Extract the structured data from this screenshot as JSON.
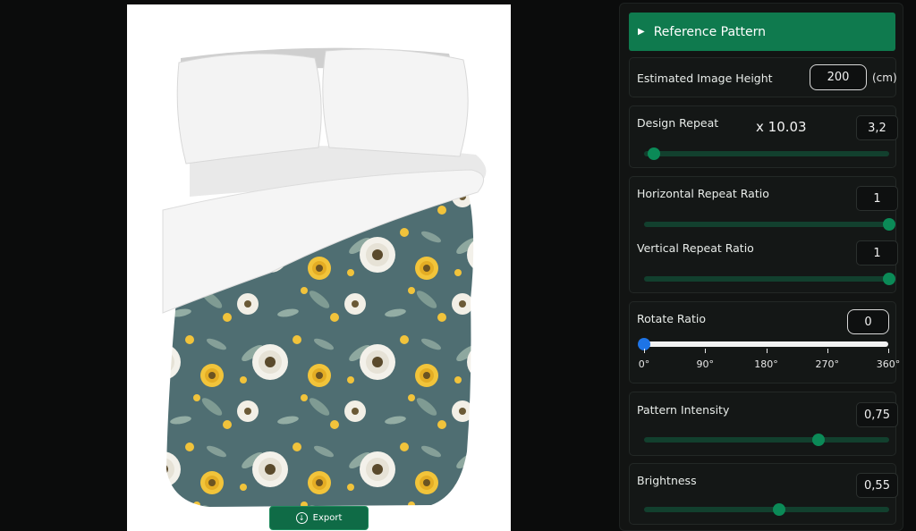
{
  "preview": {
    "export_label": "Export",
    "export_icon": "download-icon"
  },
  "panel": {
    "reference_pattern_label": "Reference Pattern",
    "image_height": {
      "label": "Estimated Image Height",
      "value": "200",
      "unit": "(cm)"
    },
    "design_repeat": {
      "label": "Design Repeat",
      "multiplier": "x 10.03",
      "value": "3,2",
      "slider_fraction": 0.04
    },
    "horizontal_repeat": {
      "label": "Horizontal Repeat Ratio",
      "value": "1",
      "slider_fraction": 1.0
    },
    "vertical_repeat": {
      "label": "Vertical Repeat Ratio",
      "value": "1",
      "slider_fraction": 1.0
    },
    "rotate": {
      "label": "Rotate Ratio",
      "value": "0",
      "slider_fraction": 0.0,
      "ticks": [
        "0°",
        "90°",
        "180°",
        "270°",
        "360°"
      ]
    },
    "pattern_intensity": {
      "label": "Pattern Intensity",
      "value": "0,75",
      "slider_fraction": 0.71
    },
    "brightness": {
      "label": "Brightness",
      "value": "0,55",
      "slider_fraction": 0.55
    }
  },
  "colors": {
    "accent": "#0f7a4e",
    "slider_track": "#12402e",
    "rotate_thumb": "#1e74e6",
    "pattern_bg": "#4f6e72"
  }
}
